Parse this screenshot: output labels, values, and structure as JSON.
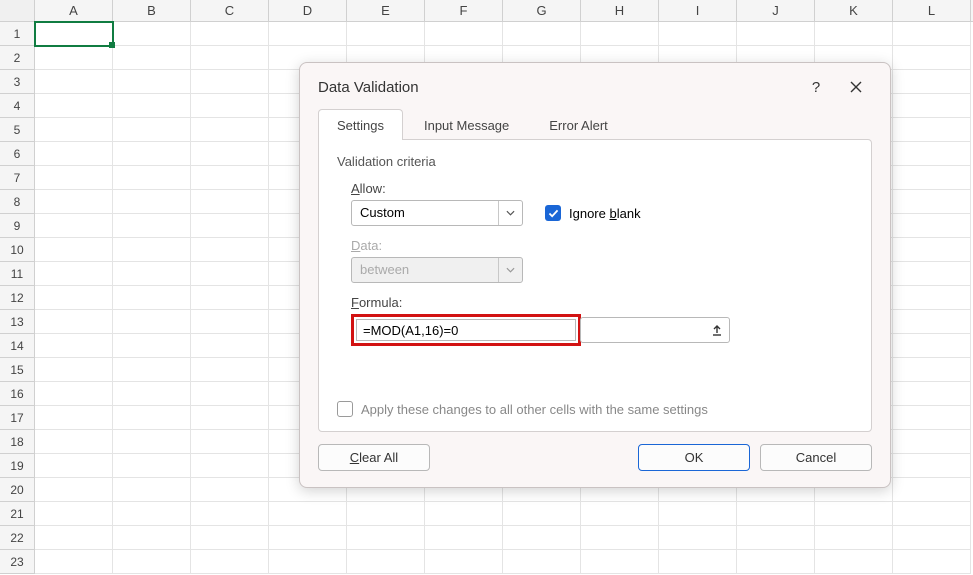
{
  "sheet": {
    "columns": [
      "A",
      "B",
      "C",
      "D",
      "E",
      "F",
      "G",
      "H",
      "I",
      "J",
      "K",
      "L"
    ],
    "row_count": 23,
    "selected_cell": "A1"
  },
  "dialog": {
    "title": "Data Validation",
    "help_symbol": "?",
    "tabs": {
      "settings": "Settings",
      "input_message": "Input Message",
      "error_alert": "Error Alert"
    },
    "criteria_label": "Validation criteria",
    "allow_label_pre": "A",
    "allow_label_rest": "llow:",
    "allow_value": "Custom",
    "ignore_blank_pre": "Ignore ",
    "ignore_blank_u": "b",
    "ignore_blank_rest": "lank",
    "data_label_pre": "D",
    "data_label_rest": "ata:",
    "data_value": "between",
    "formula_label_pre": "F",
    "formula_label_rest": "ormula:",
    "formula_value": "=MOD(A1,16)=0",
    "apply_label": "Apply these changes to all other cells with the same settings",
    "clear_all": "Clear All",
    "ok": "OK",
    "cancel": "Cancel"
  }
}
